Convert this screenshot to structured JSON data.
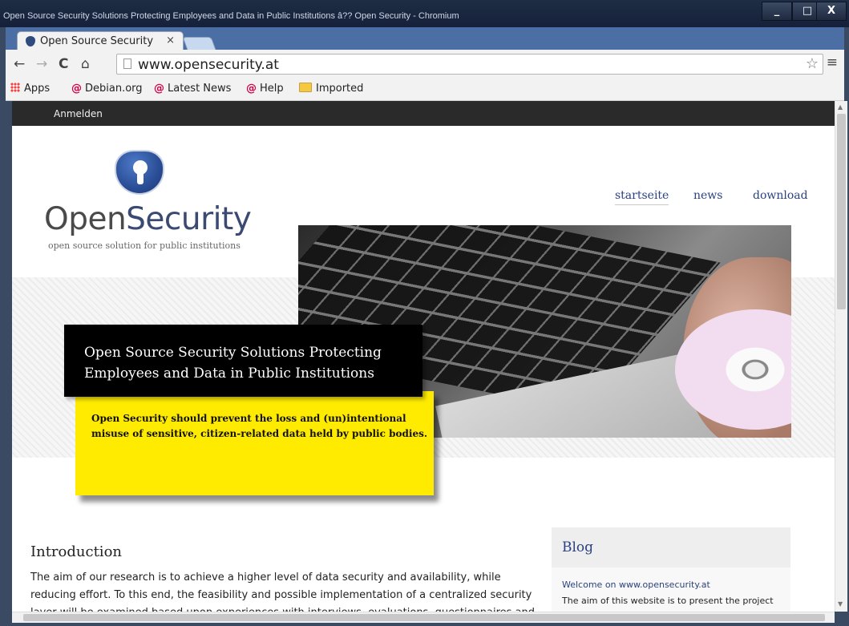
{
  "window": {
    "title": "Open Source Security Solutions Protecting Employees and Data in Public Institutions â?? Open Security - Chromium",
    "controls": {
      "minimize": "_",
      "maximize": "□",
      "close": "X"
    }
  },
  "tab": {
    "label": "Open Source Security",
    "close": "×"
  },
  "toolbar": {
    "back": "←",
    "forward": "→",
    "reload": "C",
    "home": "⌂",
    "url": "www.opensecurity.at",
    "star": "☆",
    "menu": "≡"
  },
  "bookmarks": [
    {
      "label": "Apps"
    },
    {
      "label": "Debian.org"
    },
    {
      "label": "Latest News"
    },
    {
      "label": "Help"
    },
    {
      "label": "Imported"
    }
  ],
  "admin_bar": {
    "login": "Anmelden"
  },
  "site": {
    "logo_text_1": "Open",
    "logo_text_2": "Security",
    "tagline": "open source solution for public institutions",
    "nav": [
      {
        "label": "startseite"
      },
      {
        "label": "news"
      },
      {
        "label": "download"
      }
    ],
    "hero_title": "Open Source Security Solutions Protecting Employees and Data in Public Institutions",
    "hero_subtitle": "Open Security should prevent the loss and (un)intentional misuse of sensitive, citizen-related data held by public bodies.",
    "intro_heading": "Introduction",
    "intro_body": "The aim of our research is to achieve a higher level of data security and availability, while reducing effort. To this end, the feasibility and possible implementation of a centralized security layer will be examined based upon experiences with interviews, evaluations, questionnaires and prototyping. Third",
    "blog_heading": "Blog",
    "blog_post_title": "Welcome on www.opensecurity.at",
    "blog_post_text": "The aim of this website is to present the project"
  }
}
